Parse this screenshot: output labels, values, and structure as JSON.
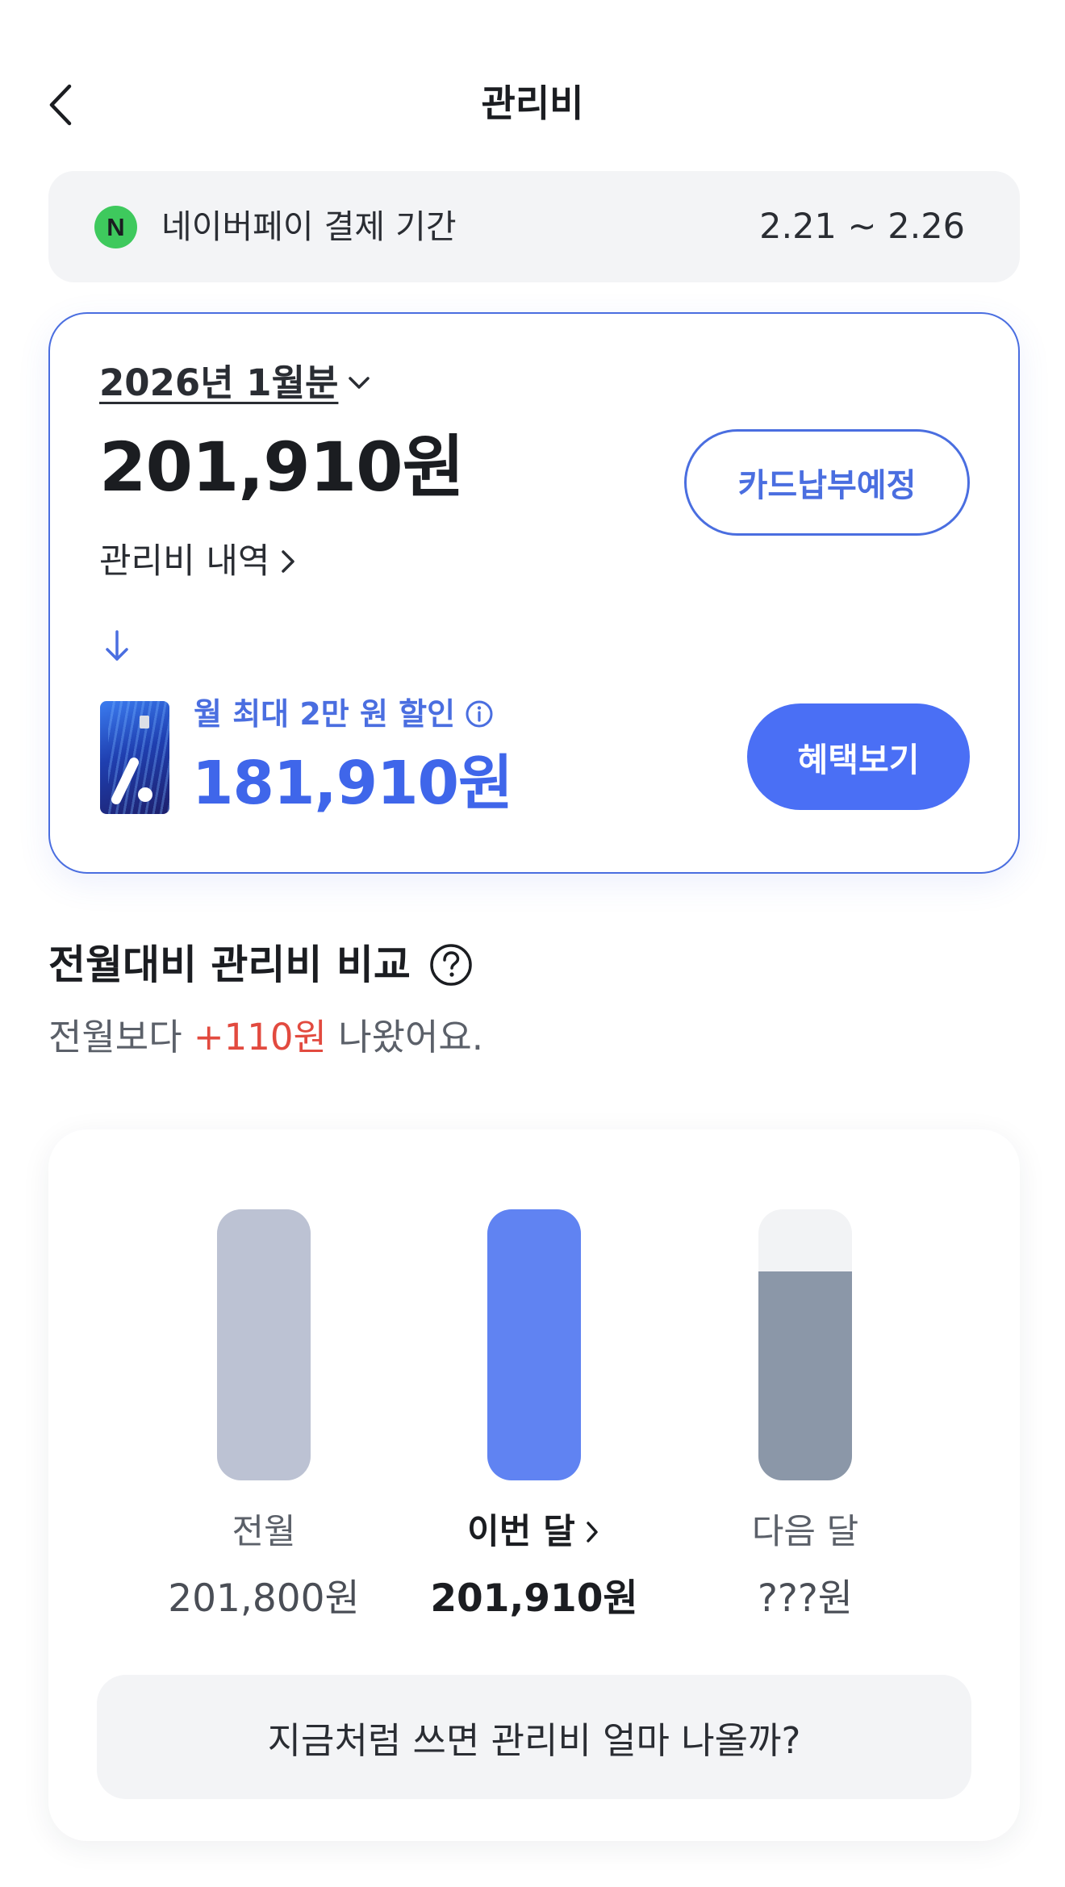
{
  "header": {
    "title": "관리비"
  },
  "payment_period": {
    "logo_letter": "N",
    "label": "네이버페이 결제 기간",
    "range": "2.21 ~ 2.26"
  },
  "fee_card": {
    "month": "2026년 1월분",
    "amount": "201,910원",
    "detail_link": "관리비 내역",
    "card_pay_button": "카드납부예정",
    "discount_label": "월 최대 2만 원 할인",
    "discounted_amount": "181,910원",
    "benefit_button": "혜택보기"
  },
  "compare": {
    "title": "전월대비 관리비 비교",
    "subtitle_prefix": "전월보다 ",
    "difference": "+110원",
    "subtitle_suffix": " 나왔어요.",
    "columns": [
      {
        "label": "전월",
        "value": "201,800원",
        "fill": 1.0,
        "color": "#bcc2d3"
      },
      {
        "label": "이번 달",
        "value": "201,910원",
        "fill": 1.0,
        "color": "#6083f2"
      },
      {
        "label": "다음 달",
        "value": "???원",
        "fill": 0.77,
        "color": "#8b97a8"
      }
    ],
    "forecast_button": "지금처럼 쓰면 관리비 얼마 나올까?"
  },
  "colors": {
    "accent": "#4a6ee0",
    "benefit_button": "#4a6ff5",
    "increase": "#e24a3f",
    "naver_green": "#3ec95d"
  },
  "icons": [
    "back-arrow-icon",
    "chevron-down-icon",
    "chevron-right-icon",
    "arrow-down-icon",
    "info-icon",
    "help-icon"
  ]
}
